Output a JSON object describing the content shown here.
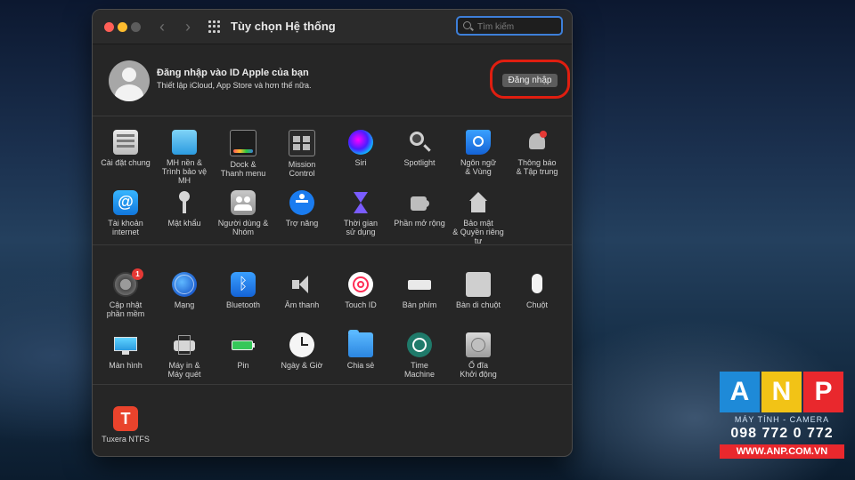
{
  "window": {
    "title": "Tùy chọn Hệ thống"
  },
  "search": {
    "placeholder": "Tìm kiếm"
  },
  "account": {
    "title": "Đăng nhập vào ID Apple của bạn",
    "subtitle": "Thiết lập iCloud, App Store và hơn thế nữa.",
    "sign_in_label": "Đăng nhập"
  },
  "section1": {
    "row1": [
      {
        "label": "Cài đặt chung",
        "icon": "general-icon"
      },
      {
        "label": "MH nền &\nTrình bảo vệ MH",
        "icon": "desktop-icon"
      },
      {
        "label": "Dock &\nThanh menu",
        "icon": "dock-icon"
      },
      {
        "label": "Mission\nControl",
        "icon": "mission-control-icon"
      },
      {
        "label": "Siri",
        "icon": "siri-icon"
      },
      {
        "label": "Spotlight",
        "icon": "spotlight-icon"
      },
      {
        "label": "Ngôn ngữ\n& Vùng",
        "icon": "language-icon"
      },
      {
        "label": "Thông báo\n& Tập trung",
        "icon": "notifications-icon"
      }
    ],
    "row2": [
      {
        "label": "Tài khoản\ninternet",
        "icon": "internet-accounts-icon"
      },
      {
        "label": "Mật khẩu",
        "icon": "passwords-icon"
      },
      {
        "label": "Người dùng &\nNhóm",
        "icon": "users-icon"
      },
      {
        "label": "Trợ năng",
        "icon": "accessibility-icon"
      },
      {
        "label": "Thời gian\nsử dụng",
        "icon": "screen-time-icon"
      },
      {
        "label": "Phần mở rộng",
        "icon": "extensions-icon"
      },
      {
        "label": "Bảo mật\n& Quyền riêng tư",
        "icon": "security-icon"
      }
    ]
  },
  "section2": {
    "row1": [
      {
        "label": "Cập nhật\nphần mềm",
        "icon": "software-update-icon",
        "badge": "1"
      },
      {
        "label": "Mạng",
        "icon": "network-icon"
      },
      {
        "label": "Bluetooth",
        "icon": "bluetooth-icon"
      },
      {
        "label": "Âm thanh",
        "icon": "sound-icon"
      },
      {
        "label": "Touch ID",
        "icon": "touch-id-icon"
      },
      {
        "label": "Bàn phím",
        "icon": "keyboard-icon"
      },
      {
        "label": "Bàn di chuột",
        "icon": "trackpad-icon"
      },
      {
        "label": "Chuột",
        "icon": "mouse-icon"
      }
    ],
    "row2": [
      {
        "label": "Màn hình",
        "icon": "displays-icon"
      },
      {
        "label": "Máy in &\nMáy quét",
        "icon": "printers-icon"
      },
      {
        "label": "Pin",
        "icon": "battery-icon"
      },
      {
        "label": "Ngày & Giờ",
        "icon": "date-time-icon"
      },
      {
        "label": "Chia sẻ",
        "icon": "sharing-icon"
      },
      {
        "label": "Time\nMachine",
        "icon": "time-machine-icon"
      },
      {
        "label": "Ổ đĩa\nKhởi động",
        "icon": "startup-disk-icon"
      }
    ]
  },
  "section3": {
    "row1": [
      {
        "label": "Tuxera NTFS",
        "icon": "tuxera-icon"
      }
    ]
  },
  "watermark": {
    "letters": [
      "A",
      "N",
      "P"
    ],
    "tagline": "MÁY TÍNH - CAMERA",
    "phone": "098 772 0 772",
    "website": "WWW.ANP.COM.VN"
  },
  "colors": {
    "accent": "#3d7fd9",
    "highlight_ring": "#e01e10",
    "window_bg": "#262626"
  }
}
